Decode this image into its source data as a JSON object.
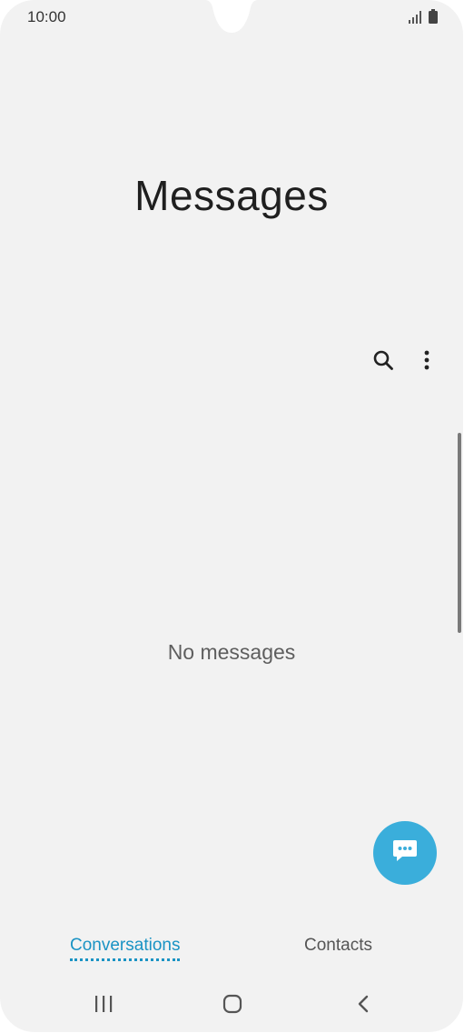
{
  "status_bar": {
    "time": "10:00",
    "icons": [
      "signal-icon",
      "battery-icon"
    ]
  },
  "header": {
    "title": "Messages"
  },
  "toolbar": {
    "icons": [
      "search-icon",
      "more-options-icon"
    ]
  },
  "main": {
    "empty_text": "No messages"
  },
  "fab": {
    "icon": "new-message-icon",
    "color": "#3aaedb"
  },
  "tabs": [
    {
      "label": "Conversations",
      "active": true
    },
    {
      "label": "Contacts",
      "active": false
    }
  ],
  "navigation": {
    "icons": [
      "recent-apps-icon",
      "home-icon",
      "back-icon"
    ]
  },
  "colors": {
    "accent": "#1a93c4",
    "background": "#f2f2f2"
  }
}
